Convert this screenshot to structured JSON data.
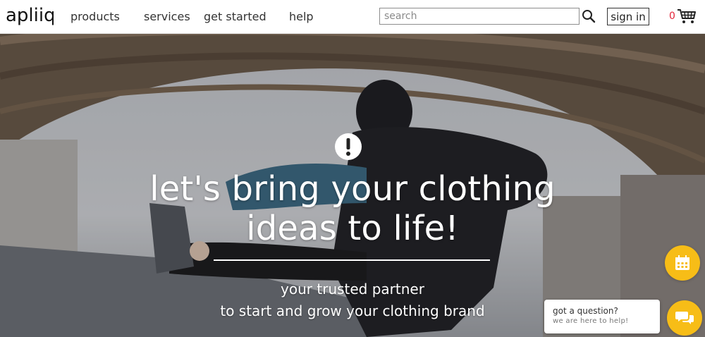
{
  "header": {
    "logo_text": "apliiq",
    "nav": [
      {
        "label": "products"
      },
      {
        "label": "services"
      },
      {
        "label": "get started"
      },
      {
        "label": "help"
      }
    ],
    "search": {
      "placeholder": "search",
      "value": ""
    },
    "signin_label": "sign in",
    "cart_count": "0"
  },
  "hero": {
    "headline_line1": "let's bring your clothing",
    "headline_line2": "ideas to life!",
    "subline1": "your trusted partner",
    "subline2": "to start and grow your clothing brand"
  },
  "chat": {
    "question": "got a question?",
    "sub": "we are here to help!"
  },
  "colors": {
    "accent_yellow": "#f7bd17",
    "cart_red": "#e4263a",
    "text_dark": "#333333"
  },
  "icons": [
    "search-icon",
    "cart-icon",
    "alert-icon",
    "calendar-icon",
    "chat-icon"
  ]
}
